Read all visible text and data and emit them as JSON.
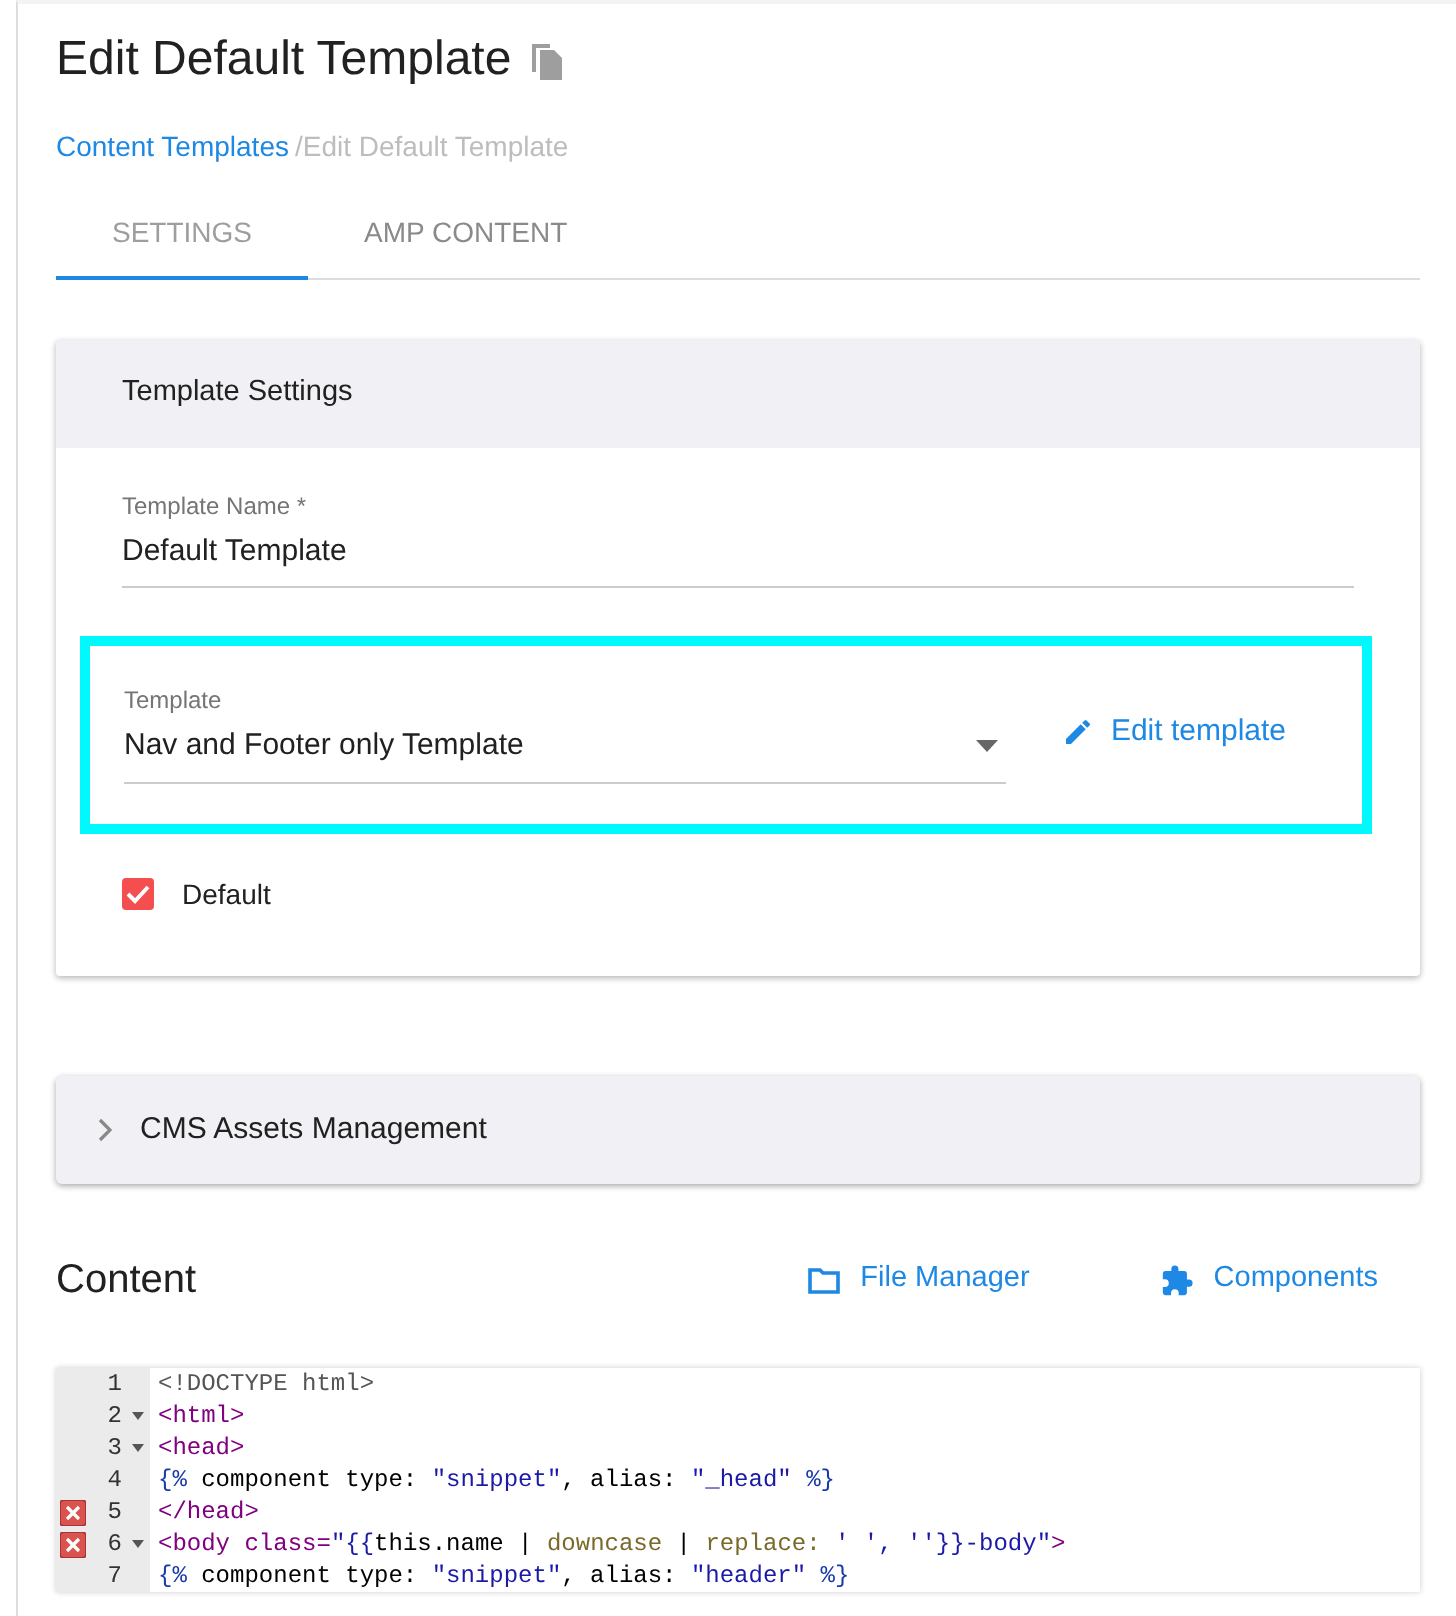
{
  "page": {
    "title": "Edit Default Template"
  },
  "breadcrumb": [
    {
      "label": "Content Templates",
      "link": true
    },
    {
      "label": "/Edit Default Template",
      "link": false
    }
  ],
  "tabs": [
    {
      "label": "SETTINGS",
      "selected": true
    },
    {
      "label": "AMP CONTENT",
      "selected": false
    }
  ],
  "settings_card": {
    "header": "Template Settings",
    "name_field": {
      "label": "Template Name *",
      "value": "Default Template"
    },
    "template_select": {
      "label": "Template",
      "value": "Nav and Footer only Template",
      "highlighted": true
    },
    "edit_link": "Edit template",
    "default_checkbox": {
      "label": "Default",
      "checked": true
    }
  },
  "accordion": {
    "label": "CMS Assets Management",
    "expanded": false
  },
  "content": {
    "heading": "Content",
    "actions": [
      "File Manager",
      "Components"
    ]
  },
  "editor": {
    "lines": [
      {
        "number": "1",
        "fold": false,
        "error": false,
        "segments": [
          {
            "kind": "doctype",
            "text": "<!DOCTYPE html>"
          }
        ]
      },
      {
        "number": "2",
        "fold": true,
        "error": false,
        "segments": [
          {
            "kind": "tag",
            "text": "<html>"
          }
        ]
      },
      {
        "number": "3",
        "fold": true,
        "error": false,
        "segments": [
          {
            "kind": "tag",
            "text": "<head>"
          }
        ]
      },
      {
        "number": "4",
        "fold": false,
        "error": false,
        "segments": [
          {
            "kind": "liquid",
            "text": "{%"
          },
          {
            "kind": "plain",
            "text": " component type: "
          },
          {
            "kind": "string",
            "text": "\"snippet\""
          },
          {
            "kind": "plain",
            "text": ", alias: "
          },
          {
            "kind": "string",
            "text": "\"_head\""
          },
          {
            "kind": "liquid",
            "text": " %}"
          }
        ]
      },
      {
        "number": "5",
        "fold": false,
        "error": true,
        "segments": [
          {
            "kind": "tag",
            "text": "</head>"
          }
        ]
      },
      {
        "number": "6",
        "fold": true,
        "error": true,
        "segments": [
          {
            "kind": "tag",
            "text": "<body"
          },
          {
            "kind": "attr",
            "text": " class="
          },
          {
            "kind": "string",
            "text": "\"{{"
          },
          {
            "kind": "plain",
            "text": "this.name | "
          },
          {
            "kind": "filter",
            "text": "downcase"
          },
          {
            "kind": "plain",
            "text": " | "
          },
          {
            "kind": "filter",
            "text": "replace:"
          },
          {
            "kind": "string",
            "text": " ' ', ''}}-body\""
          },
          {
            "kind": "tag",
            "text": ">"
          }
        ]
      },
      {
        "number": "7",
        "fold": false,
        "error": false,
        "segments": [
          {
            "kind": "liquid",
            "text": "{%"
          },
          {
            "kind": "plain",
            "text": " component type: "
          },
          {
            "kind": "string",
            "text": "\"snippet\""
          },
          {
            "kind": "plain",
            "text": ", alias: "
          },
          {
            "kind": "string",
            "text": "\"header\""
          },
          {
            "kind": "liquid",
            "text": " %}"
          }
        ]
      }
    ]
  }
}
